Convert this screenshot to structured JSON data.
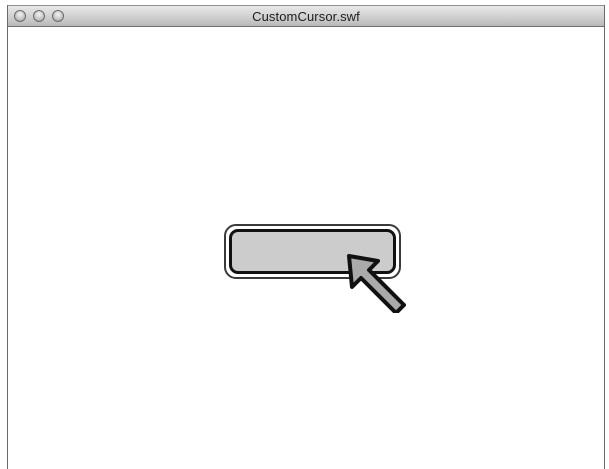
{
  "window": {
    "title": "CustomCursor.swf"
  },
  "titlebar": {
    "buttons": [
      "close",
      "minimize",
      "zoom"
    ]
  },
  "stage": {
    "button": {
      "label": "",
      "fill_color": "#cccccc",
      "border_color": "#111111"
    },
    "cursor": {
      "icon": "arrow-cursor-icon",
      "fill_color": "#aaaaaa",
      "outline_color": "#111111"
    }
  }
}
